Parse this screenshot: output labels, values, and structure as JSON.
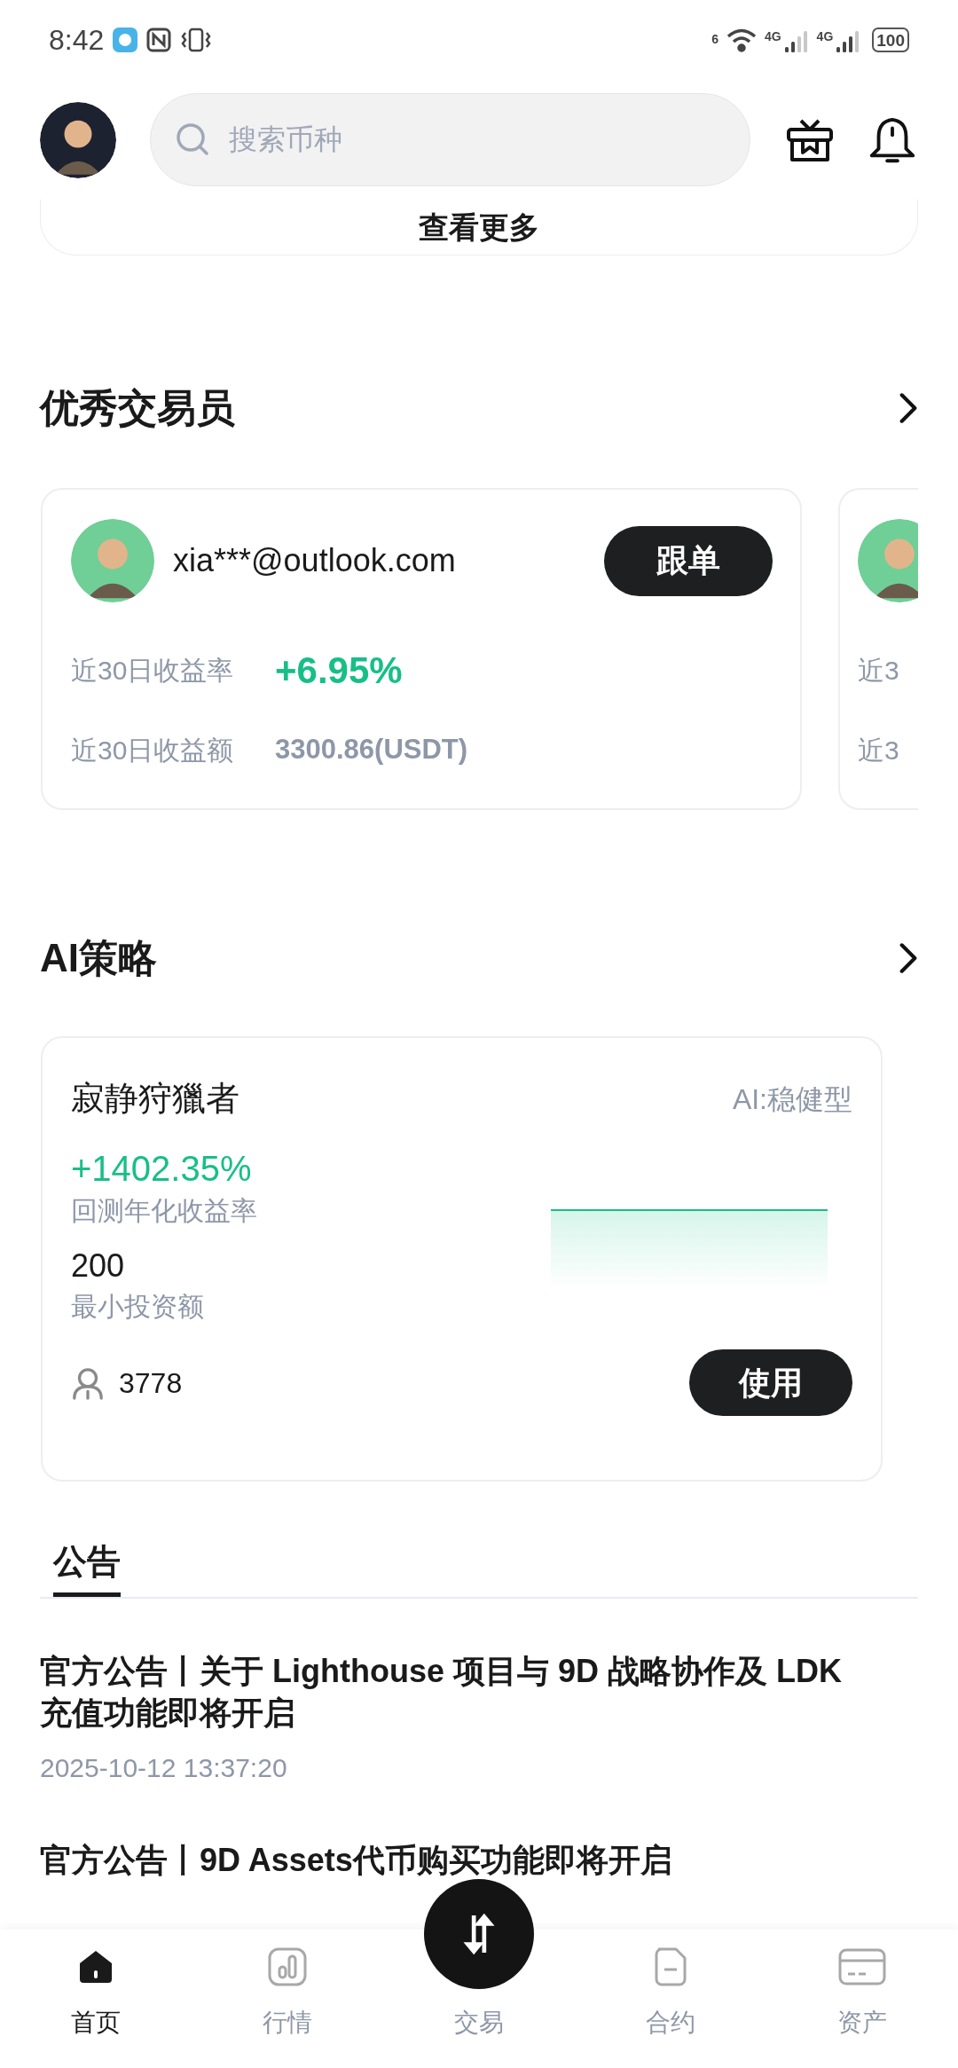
{
  "status_bar": {
    "time": "8:42",
    "wifi_label": "6",
    "network_labels": [
      "4G",
      "4G"
    ],
    "battery": "100"
  },
  "header": {
    "search": {
      "placeholder": "搜索币种"
    }
  },
  "top_card": {
    "button": "查看更多"
  },
  "traders": {
    "title": "优秀交易员",
    "cards": [
      {
        "email": "xia***@outlook.com",
        "button": "跟单",
        "rate_label": "近30日收益率",
        "rate_value": "+6.95%",
        "amount_label": "近30日收益额",
        "amount_value": "3300.86(USDT)"
      },
      {
        "rate_label": "近3",
        "amount_label": "近3"
      }
    ]
  },
  "ai": {
    "title": "AI策略",
    "card": {
      "name": "寂静狩獵者",
      "tag": "AI:稳健型",
      "return_value": "+1402.35%",
      "return_label": "回测年化收益率",
      "min_value": "200",
      "min_label": "最小投资额",
      "users": "3778",
      "button": "使用"
    }
  },
  "announcements": {
    "tabs": [
      {
        "label": "公告",
        "selected": true
      }
    ],
    "items": [
      {
        "title": "官方公告丨关于 Lighthouse 项目与 9D 战略协作及 LDK 充值功能即将开启",
        "date": "2025-10-12  13:37:20"
      },
      {
        "title": "官方公告丨9D Assets代币购买功能即将开启"
      }
    ]
  },
  "nav": {
    "items": [
      {
        "label": "首页",
        "kind": "home",
        "selected": true
      },
      {
        "label": "行情",
        "kind": "market",
        "selected": false
      },
      {
        "label": "交易",
        "kind": "trade",
        "selected": false
      },
      {
        "label": "合约",
        "kind": "contract",
        "selected": false
      },
      {
        "label": "资产",
        "kind": "assets",
        "selected": false
      }
    ]
  }
}
